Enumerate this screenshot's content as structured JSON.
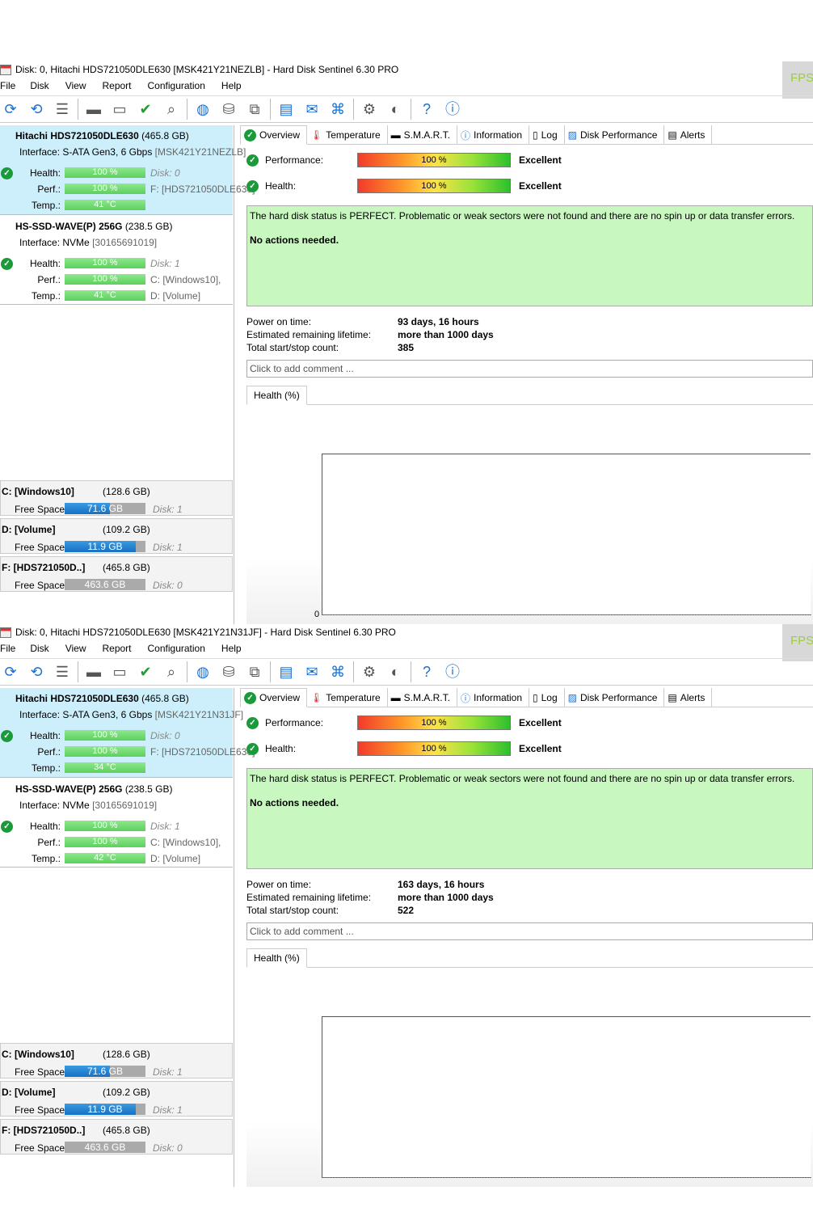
{
  "windows": [
    {
      "title": "Disk: 0, Hitachi HDS721050DLE630 [MSK421Y21NEZLB]  -  Hard Disk Sentinel 6.30 PRO",
      "fps_label": "FPS",
      "menu": [
        "File",
        "Disk",
        "View",
        "Report",
        "Configuration",
        "Help"
      ],
      "disks": [
        {
          "name": "Hitachi HDS721050DLE630",
          "size": "(465.8 GB)",
          "iface_label": "Interface:",
          "iface": "S-ATA Gen3, 6 Gbps",
          "serial": "[MSK421Y21NEZLB]",
          "health_label": "Health:",
          "health": "100 %",
          "health_right": "Disk: 0",
          "perf_label": "Perf.:",
          "perf": "100 %",
          "perf_right": "F: [HDS721050DLE630]",
          "temp_label": "Temp.:",
          "temp": "41 °C",
          "temp_right": ""
        },
        {
          "name": "HS-SSD-WAVE(P) 256G",
          "size": "(238.5 GB)",
          "iface_label": "Interface:",
          "iface": "NVMe",
          "serial": "[30165691019]",
          "health_label": "Health:",
          "health": "100 %",
          "health_right": "Disk: 1",
          "perf_label": "Perf.:",
          "perf": "100 %",
          "perf_right": "C: [Windows10],",
          "temp_label": "Temp.:",
          "temp": "41 °C",
          "temp_right": "D: [Volume]"
        }
      ],
      "volumes": [
        {
          "name": "C: [Windows10]",
          "size": "(128.6 GB)",
          "free_label": "Free Space",
          "free": "71.6 GB",
          "fill": 0.56,
          "disk": "Disk: 1"
        },
        {
          "name": "D: [Volume]",
          "size": "(109.2 GB)",
          "free_label": "Free Space",
          "free": "11.9 GB",
          "fill": 0.88,
          "disk": "Disk: 1"
        },
        {
          "name": "F: [HDS721050D..]",
          "size": "(465.8 GB)",
          "free_label": "Free Space",
          "free": "463.6 GB",
          "fill": 0,
          "disk": "Disk: 0"
        }
      ],
      "tabs": [
        "Overview",
        "Temperature",
        "S.M.A.R.T.",
        "Information",
        "Log",
        "Disk Performance",
        "Alerts"
      ],
      "performance_label": "Performance:",
      "performance_value": "100 %",
      "performance_rating": "Excellent",
      "health_label": "Health:",
      "health_value": "100 %",
      "health_rating": "Excellent",
      "status_message": "The hard disk status is PERFECT. Problematic or weak sectors were not found and there are no spin up or data transfer errors.",
      "status_action": "No actions needed.",
      "power_on_label": "Power on time:",
      "power_on": "93 days, 16 hours",
      "lifetime_label": "Estimated remaining lifetime:",
      "lifetime": "more than 1000 days",
      "startstop_label": "Total start/stop count:",
      "startstop": "385",
      "comment_placeholder": "Click to add comment ...",
      "graph_tab": "Health (%)",
      "graph_zero": "0"
    },
    {
      "title": "Disk: 0, Hitachi HDS721050DLE630 [MSK421Y21N31JF]  -  Hard Disk Sentinel 6.30 PRO",
      "fps_label": "FPS",
      "menu": [
        "File",
        "Disk",
        "View",
        "Report",
        "Configuration",
        "Help"
      ],
      "disks": [
        {
          "name": "Hitachi HDS721050DLE630",
          "size": "(465.8 GB)",
          "iface_label": "Interface:",
          "iface": "S-ATA Gen3, 6 Gbps",
          "serial": "[MSK421Y21N31JF]",
          "health_label": "Health:",
          "health": "100 %",
          "health_right": "Disk: 0",
          "perf_label": "Perf.:",
          "perf": "100 %",
          "perf_right": "F: [HDS721050DLE630]",
          "temp_label": "Temp.:",
          "temp": "34 °C",
          "temp_right": ""
        },
        {
          "name": "HS-SSD-WAVE(P) 256G",
          "size": "(238.5 GB)",
          "iface_label": "Interface:",
          "iface": "NVMe",
          "serial": "[30165691019]",
          "health_label": "Health:",
          "health": "100 %",
          "health_right": "Disk: 1",
          "perf_label": "Perf.:",
          "perf": "100 %",
          "perf_right": "C: [Windows10],",
          "temp_label": "Temp.:",
          "temp": "42 °C",
          "temp_right": "D: [Volume]"
        }
      ],
      "volumes": [
        {
          "name": "C: [Windows10]",
          "size": "(128.6 GB)",
          "free_label": "Free Space",
          "free": "71.6 GB",
          "fill": 0.56,
          "disk": "Disk: 1"
        },
        {
          "name": "D: [Volume]",
          "size": "(109.2 GB)",
          "free_label": "Free Space",
          "free": "11.9 GB",
          "fill": 0.88,
          "disk": "Disk: 1"
        },
        {
          "name": "F: [HDS721050D..]",
          "size": "(465.8 GB)",
          "free_label": "Free Space",
          "free": "463.6 GB",
          "fill": 0,
          "disk": "Disk: 0"
        }
      ],
      "tabs": [
        "Overview",
        "Temperature",
        "S.M.A.R.T.",
        "Information",
        "Log",
        "Disk Performance",
        "Alerts"
      ],
      "performance_label": "Performance:",
      "performance_value": "100 %",
      "performance_rating": "Excellent",
      "health_label": "Health:",
      "health_value": "100 %",
      "health_rating": "Excellent",
      "status_message": "The hard disk status is PERFECT. Problematic or weak sectors were not found and there are no spin up or data transfer errors.",
      "status_action": "No actions needed.",
      "power_on_label": "Power on time:",
      "power_on": "163 days, 16 hours",
      "lifetime_label": "Estimated remaining lifetime:",
      "lifetime": "more than 1000 days",
      "startstop_label": "Total start/stop count:",
      "startstop": "522",
      "comment_placeholder": "Click to add comment ...",
      "graph_tab": "Health (%)",
      "graph_zero": ""
    }
  ],
  "toolbar_icons": [
    "refresh-icon",
    "refresh-warning-icon",
    "disk-list-icon",
    "disk-icon",
    "disk-schedule-icon",
    "disk-check-icon",
    "disk-search-icon",
    "globe-disk-icon",
    "hdd-icon",
    "copy-disk-icon",
    "notes-icon",
    "mail-icon",
    "network-icon",
    "settings-icon",
    "sound-icon",
    "help-icon",
    "info-icon"
  ],
  "tab_icons": [
    "check-icon",
    "thermometer-icon",
    "smart-icon",
    "info-icon",
    "log-icon",
    "performance-icon",
    "alerts-icon"
  ],
  "colors": {
    "selected_disk": "#cdeffb",
    "status_bg": "#c8f7c0",
    "ok_green": "#1a9a3a",
    "bar_green": "#5ccf5c",
    "volume_blue": "#1670c4"
  }
}
